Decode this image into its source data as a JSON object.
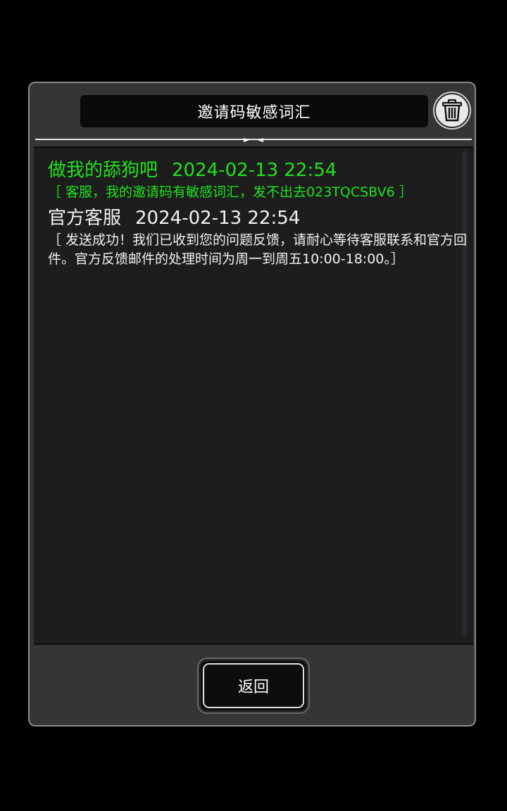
{
  "dialog": {
    "title": "邀请码敏感词汇",
    "trash_icon": "trash-icon",
    "back_label": "返回"
  },
  "messages": [
    {
      "sender": "做我的舔狗吧",
      "time": "2024-02-13 22:54",
      "body": "［ 客服，我的邀请码有敏感词汇，发不出去023TQCSBV6 ］",
      "color": "#1fe21f"
    },
    {
      "sender": "官方客服",
      "time": "2024-02-13 22:54",
      "body": "［ 发送成功！我们已收到您的问题反馈，请耐心等待客服联系和官方回件。官方反馈邮件的处理时间为周一到周五10:00-18:00。］",
      "color": "#f2f2f2"
    }
  ]
}
